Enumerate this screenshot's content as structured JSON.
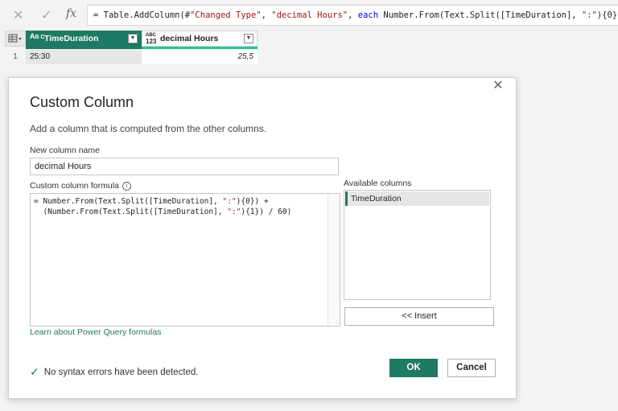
{
  "formula_bar": {
    "cancel_icon": "close-icon",
    "commit_icon": "check-icon",
    "fx_label": "fx",
    "parts": [
      {
        "t": "= Table.AddColumn(#",
        "c": "plain"
      },
      {
        "t": "\"Changed Type\"",
        "c": "str"
      },
      {
        "t": ", ",
        "c": "plain"
      },
      {
        "t": "\"decimal Hours\"",
        "c": "str"
      },
      {
        "t": ", ",
        "c": "plain"
      },
      {
        "t": "each",
        "c": "kw"
      },
      {
        "t": " Number.From(Text.Split([TimeDuration], ",
        "c": "plain"
      },
      {
        "t": "\":\"",
        "c": "str"
      },
      {
        "t": "){0}) +",
        "c": "plain"
      }
    ]
  },
  "grid": {
    "columns": [
      {
        "type_label_top": "A",
        "type_label_bottom": "B C",
        "type_icon": "text-type-icon",
        "name": "TimeDuration"
      },
      {
        "type_label_top": "ABC",
        "type_label_bottom": "123",
        "type_icon": "any-type-icon",
        "name": "decimal Hours"
      }
    ],
    "rows": [
      {
        "num": "1",
        "cells": [
          "25:30",
          "25,5"
        ]
      }
    ]
  },
  "dialog": {
    "title": "Custom Column",
    "description": "Add a column that is computed from the other columns.",
    "new_column_label": "New column name",
    "new_column_value": "decimal Hours",
    "formula_label": "Custom column formula",
    "formula_line1": "= Number.From(Text.Split([TimeDuration], \":\"){0}) +",
    "formula_line2": "  (Number.From(Text.Split([TimeDuration], \":\"){1}) / 60)",
    "available_label": "Available columns",
    "available_items": [
      "TimeDuration"
    ],
    "insert_label": "<< Insert",
    "learn_link": "Learn about Power Query formulas",
    "status_text": "No syntax errors have been detected.",
    "ok_label": "OK",
    "cancel_label": "Cancel"
  },
  "colors": {
    "accent": "#1e7a63",
    "string": "#a31515",
    "keyword": "#0000ff"
  }
}
